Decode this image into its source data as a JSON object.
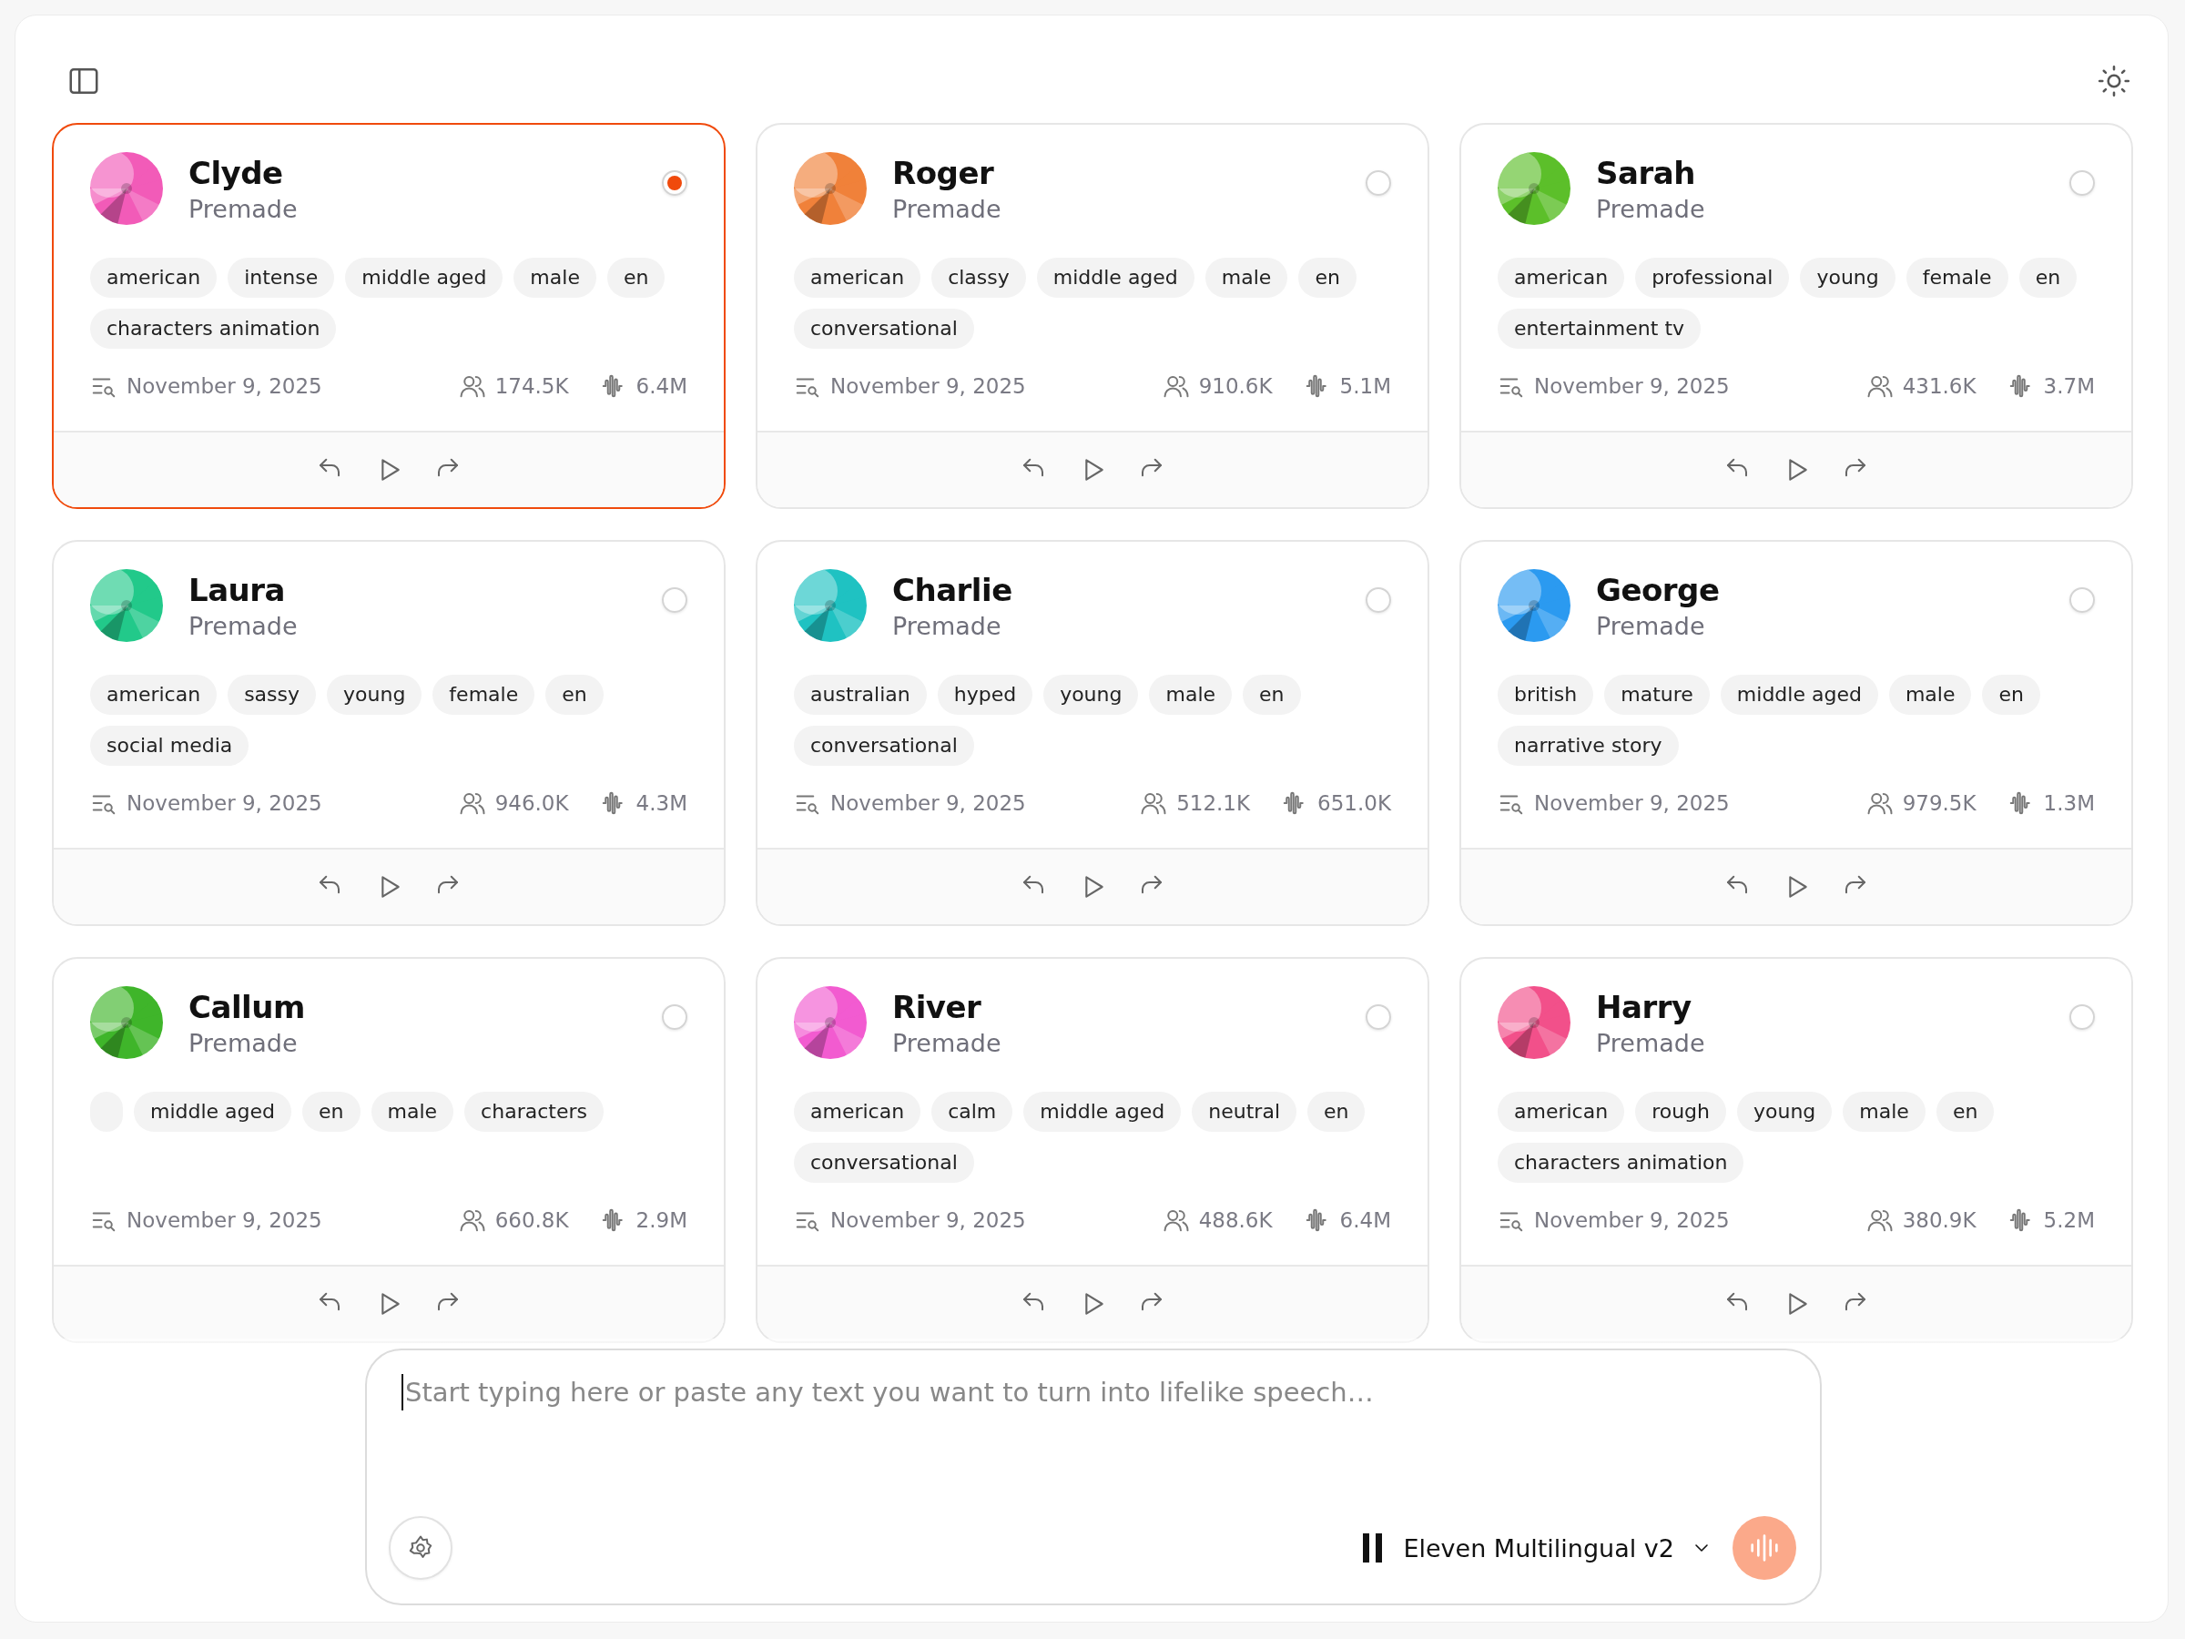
{
  "voices": [
    {
      "name": "Clyde",
      "category": "Premade",
      "color": "#f25bb8",
      "selected": true,
      "tags": [
        "american",
        "intense",
        "middle aged",
        "male",
        "en",
        "characters animation"
      ],
      "date": "November 9, 2025",
      "users": "174.5K",
      "plays": "6.4M"
    },
    {
      "name": "Roger",
      "category": "Premade",
      "color": "#f0813a",
      "selected": false,
      "tags": [
        "american",
        "classy",
        "middle aged",
        "male",
        "en",
        "conversational"
      ],
      "date": "November 9, 2025",
      "users": "910.6K",
      "plays": "5.1M"
    },
    {
      "name": "Sarah",
      "category": "Premade",
      "color": "#5cbf2a",
      "selected": false,
      "tags": [
        "american",
        "professional",
        "young",
        "female",
        "en",
        "entertainment tv"
      ],
      "date": "November 9, 2025",
      "users": "431.6K",
      "plays": "3.7M"
    },
    {
      "name": "Laura",
      "category": "Premade",
      "color": "#22c98a",
      "selected": false,
      "tags": [
        "american",
        "sassy",
        "young",
        "female",
        "en",
        "social media"
      ],
      "date": "November 9, 2025",
      "users": "946.0K",
      "plays": "4.3M"
    },
    {
      "name": "Charlie",
      "category": "Premade",
      "color": "#1fc2c2",
      "selected": false,
      "tags": [
        "australian",
        "hyped",
        "young",
        "male",
        "en",
        "conversational"
      ],
      "date": "November 9, 2025",
      "users": "512.1K",
      "plays": "651.0K"
    },
    {
      "name": "George",
      "category": "Premade",
      "color": "#2b9af0",
      "selected": false,
      "tags": [
        "british",
        "mature",
        "middle aged",
        "male",
        "en",
        "narrative story"
      ],
      "date": "November 9, 2025",
      "users": "979.5K",
      "plays": "1.3M"
    },
    {
      "name": "Callum",
      "category": "Premade",
      "color": "#3fb52a",
      "selected": false,
      "leading_empty_tag": true,
      "tags": [
        "middle aged",
        "en",
        "male",
        "characters"
      ],
      "date": "November 9, 2025",
      "users": "660.8K",
      "plays": "2.9M"
    },
    {
      "name": "River",
      "category": "Premade",
      "color": "#f25bd0",
      "selected": false,
      "tags": [
        "american",
        "calm",
        "middle aged",
        "neutral",
        "en",
        "conversational"
      ],
      "date": "November 9, 2025",
      "users": "488.6K",
      "plays": "6.4M"
    },
    {
      "name": "Harry",
      "category": "Premade",
      "color": "#f2508a",
      "selected": false,
      "tags": [
        "american",
        "rough",
        "young",
        "male",
        "en",
        "characters animation"
      ],
      "date": "November 9, 2025",
      "users": "380.9K",
      "plays": "5.2M"
    }
  ],
  "composer": {
    "placeholder": "Start typing here or paste any text you want to turn into lifelike speech…",
    "model": "Eleven Multilingual v2"
  }
}
